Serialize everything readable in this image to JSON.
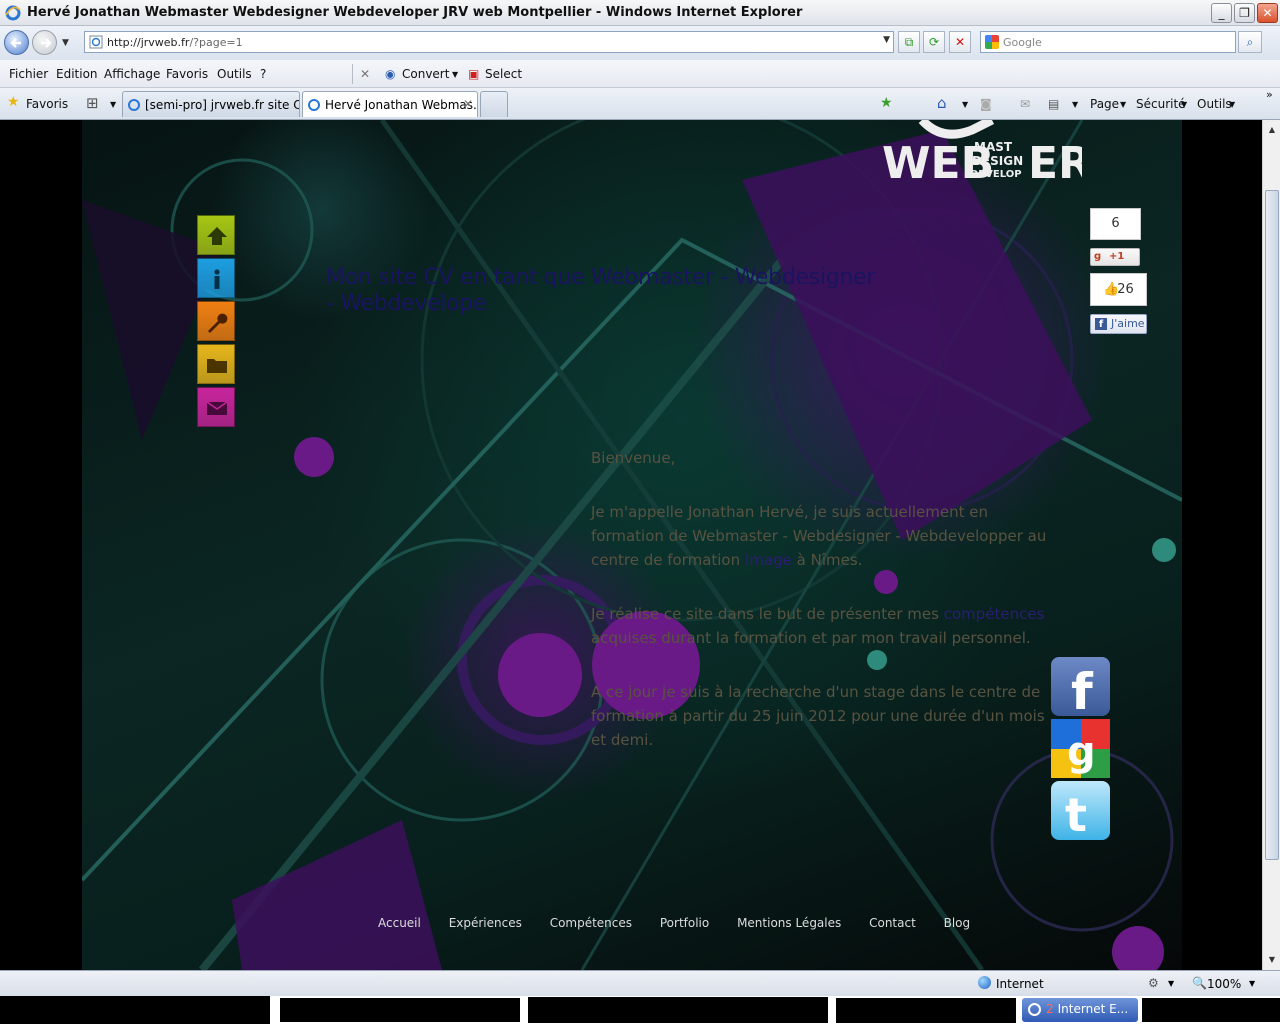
{
  "window": {
    "title": "Hervé Jonathan Webmaster Webdesigner Webdeveloper JRV web Montpellier - Windows Internet Explorer",
    "minimize": "_",
    "maximize": "❐",
    "close": "✕"
  },
  "address": {
    "url_host": "http://jrvweb.fr",
    "url_path": "/?page=1",
    "search_placeholder": "Google"
  },
  "menu": {
    "items": [
      "Fichier",
      "Edition",
      "Affichage",
      "Favoris",
      "Outils",
      "?"
    ],
    "convert": "Convert",
    "select": "Select"
  },
  "favbar": {
    "favorites": "Favoris",
    "tabs": [
      {
        "label": "[semi-pro] jrvweb.fr site CV /..."
      },
      {
        "label": "Hervé Jonathan Webmas..."
      }
    ],
    "page": "Page",
    "security": "Sécurité",
    "tools": "Outils"
  },
  "page": {
    "headline": "Mon site CV en tant que Webmaster - Webdesigner - Webdevelope",
    "paragraphs": {
      "p1": "Bienvenue,",
      "p2_a": "Je m'appelle Jonathan Hervé, je suis actuellement en formation de Webmaster - Webdesigner - Webdevelopper au centre de formation ",
      "p2_link": "Image",
      "p2_b": " à Nîmes.",
      "p3_a": "Je réalise ce site dans le but de présenter mes ",
      "p3_link": "compétences",
      "p3_b": " acquises durant la formation et par mon travail personnel.",
      "p4": "A ce jour je suis à la recherche d'un stage dans le centre de formation à partir du 25 juin 2012 pour une durée d'un mois et demi."
    },
    "social": {
      "gplus_count": "6",
      "gplus_label": "+1",
      "fb_count": "26",
      "fb_label": "J'aime"
    },
    "footer_nav": [
      "Accueil",
      "Expériences",
      "Compétences",
      "Portfolio",
      "Mentions Légales",
      "Contact",
      "Blog"
    ],
    "side_nav_colors": [
      "#a6c614",
      "#1d9ee0",
      "#f07f12",
      "#e6b51c",
      "#c8249c"
    ]
  },
  "status": {
    "zone": "Internet",
    "zoom": "100%"
  },
  "taskbar": {
    "count": "2",
    "label": "Internet E..."
  }
}
